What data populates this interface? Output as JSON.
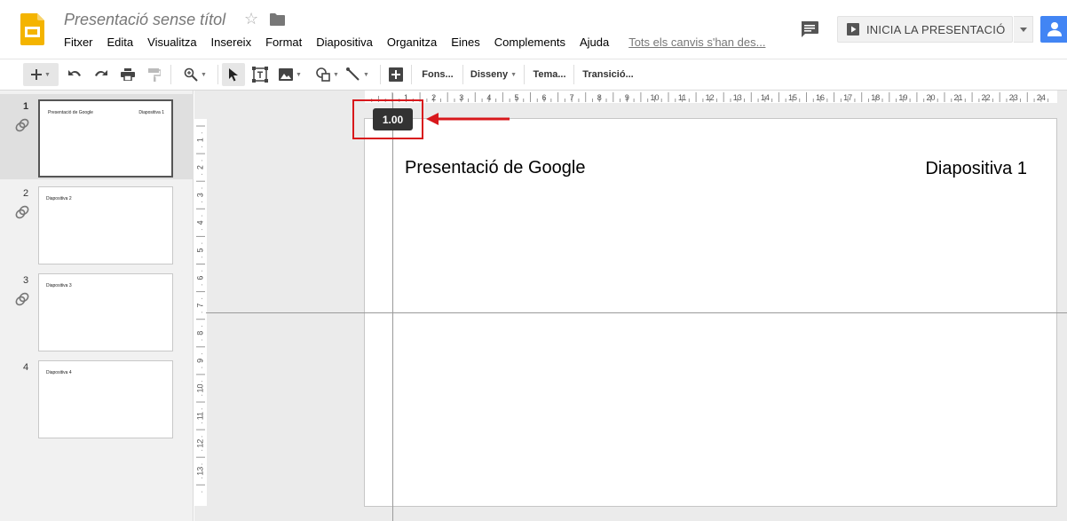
{
  "header": {
    "doc_title": "Presentació sense títol",
    "menus": [
      "Fitxer",
      "Edita",
      "Visualitza",
      "Insereix",
      "Format",
      "Diapositiva",
      "Organitza",
      "Eines",
      "Complements",
      "Ajuda"
    ],
    "saved_status": "Tots els canvis s'han des...",
    "present_label": "INICIA LA PRESENTACIÓ"
  },
  "toolbar": {
    "background_label": "Fons...",
    "layout_label": "Disseny",
    "theme_label": "Tema...",
    "transition_label": "Transició..."
  },
  "filmstrip": {
    "slides": [
      {
        "number": "1",
        "left_text": "Presentació de Google",
        "right_text": "Diapositiva 1"
      },
      {
        "number": "2",
        "left_text": "Diapositiva 2"
      },
      {
        "number": "3",
        "left_text": "Diapositiva 3"
      },
      {
        "number": "4",
        "left_text": "Diapositiva 4"
      }
    ]
  },
  "ruler": {
    "horizontal_labels": [
      "1",
      "2",
      "3",
      "4",
      "5",
      "6",
      "7",
      "8",
      "9",
      "10",
      "11",
      "12",
      "13",
      "14",
      "15",
      "16",
      "17",
      "18",
      "19",
      "20",
      "21",
      "22",
      "23",
      "24"
    ],
    "vertical_labels": [
      "1",
      "2",
      "3",
      "4",
      "5",
      "6",
      "7",
      "8",
      "9",
      "10",
      "11",
      "12",
      "13"
    ]
  },
  "slide": {
    "title": "Presentació de Google",
    "subtitle": "Diapositiva 1"
  },
  "guide_tooltip": "1.00",
  "colors": {
    "accent_blue": "#4285f4",
    "logo_yellow": "#f4b400",
    "annotation_red": "#d8181c"
  }
}
